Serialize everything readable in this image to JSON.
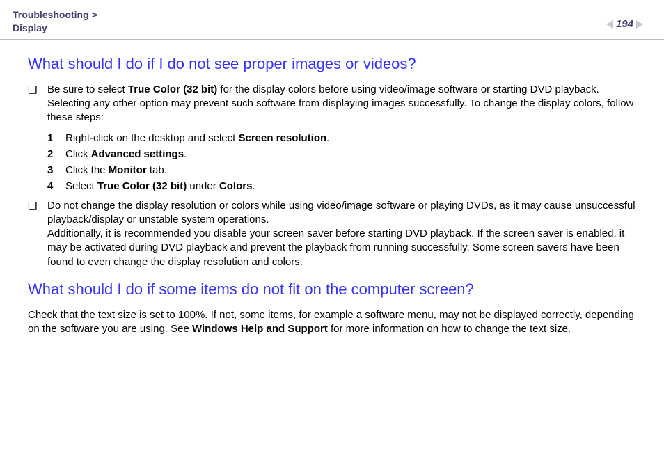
{
  "breadcrumb": {
    "section": "Troubleshooting",
    "sep": " > ",
    "page": "Display"
  },
  "page_number": "194",
  "heading1": "What should I do if I do not see proper images or videos?",
  "bullet1": {
    "pre": "Be sure to select ",
    "bold1": "True Color (32 bit)",
    "post": " for the display colors before using video/image software or starting DVD playback. Selecting any other option may prevent such software from displaying images successfully. To change the display colors, follow these steps:"
  },
  "steps": [
    {
      "num": "1",
      "pre": "Right-click on the desktop and select ",
      "bold": "Screen resolution",
      "post": "."
    },
    {
      "num": "2",
      "pre": "Click ",
      "bold": "Advanced settings",
      "post": "."
    },
    {
      "num": "3",
      "pre": "Click the ",
      "bold": "Monitor",
      "post": " tab."
    },
    {
      "num": "4",
      "pre": "Select ",
      "bold": "True Color (32 bit)",
      "post": " under ",
      "bold2": "Colors",
      "post2": "."
    }
  ],
  "bullet2": {
    "p1": "Do not change the display resolution or colors while using video/image software or playing DVDs, as it may cause unsuccessful playback/display or unstable system operations.",
    "p2": "Additionally, it is recommended you disable your screen saver before starting DVD playback. If the screen saver is enabled, it may be activated during DVD playback and prevent the playback from running successfully. Some screen savers have been found to even change the display resolution and colors."
  },
  "heading2": "What should I do if some items do not fit on the computer screen?",
  "para2": {
    "pre": "Check that the text size is set to 100%. If not, some items, for example a software menu, may not be displayed correctly, depending on the software you are using. See ",
    "bold": "Windows Help and Support",
    "post": " for more information on how to change the text size."
  }
}
